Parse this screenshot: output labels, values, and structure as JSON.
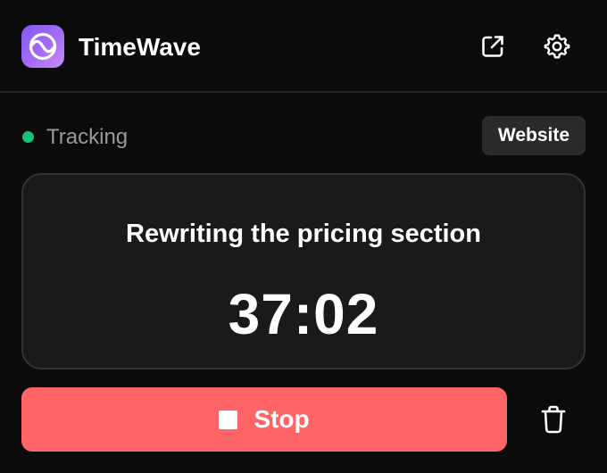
{
  "app": {
    "name": "TimeWave",
    "logo_icon": "wave-logo-icon"
  },
  "header": {
    "open_icon": "external-link-icon",
    "settings_icon": "gear-icon"
  },
  "status": {
    "label": "Tracking",
    "dot_color": "#17c07a"
  },
  "category": {
    "label": "Website"
  },
  "timer": {
    "task_name": "Rewriting the pricing section",
    "elapsed": "37:02"
  },
  "actions": {
    "stop_label": "Stop",
    "stop_icon": "stop-square-icon",
    "stop_color": "#ff6466",
    "delete_icon": "trash-icon"
  }
}
